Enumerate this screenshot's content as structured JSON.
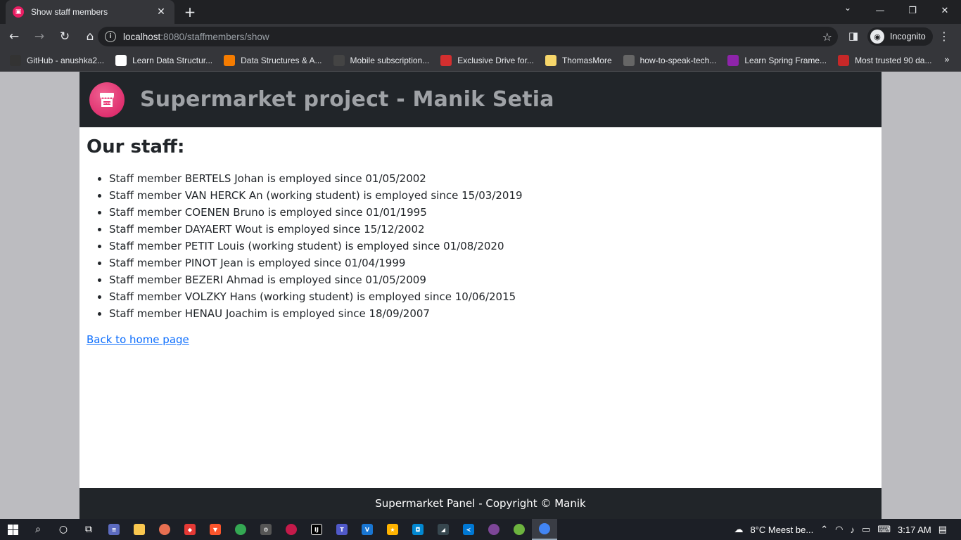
{
  "browser": {
    "tab_title": "Show staff members",
    "url_host": "localhost",
    "url_rest": ":8080/staffmembers/show",
    "profile_label": "Incognito",
    "bookmarks": [
      {
        "label": "GitHub - anushka2...",
        "icon": "github-icon",
        "color": "#333"
      },
      {
        "label": "Learn Data Structur...",
        "icon": "cc-icon",
        "color": "#fff"
      },
      {
        "label": "Data Structures & A...",
        "icon": "cc-orange-icon",
        "color": "#f57c00"
      },
      {
        "label": "Mobile subscription...",
        "icon": "mobile-icon",
        "color": "#444"
      },
      {
        "label": "Exclusive Drive for...",
        "icon": "m-red-icon",
        "color": "#d32f2f"
      },
      {
        "label": "ThomasMore",
        "icon": "folder-icon",
        "color": "#f6d66a"
      },
      {
        "label": "how-to-speak-tech...",
        "icon": "globe-icon",
        "color": "#666"
      },
      {
        "label": "Learn Spring Frame...",
        "icon": "u-purple-icon",
        "color": "#8e24aa"
      },
      {
        "label": "Most trusted 90 da...",
        "icon": "tuf-icon",
        "color": "#c62828"
      }
    ]
  },
  "header": {
    "title": "Supermarket project - Manik Setia"
  },
  "main": {
    "heading": "Our staff:",
    "staff": [
      "Staff member BERTELS Johan is employed since 01/05/2002",
      "Staff member VAN HERCK An (working student) is employed since 15/03/2019",
      "Staff member COENEN Bruno is employed since 01/01/1995",
      "Staff member DAYAERT Wout is employed since 15/12/2002",
      "Staff member PETIT Louis (working student) is employed since 01/08/2020",
      "Staff member PINOT Jean is employed since 01/04/1999",
      "Staff member BEZERI Ahmad is employed since 01/05/2009",
      "Staff member VOLZKY Hans (working student) is employed since 10/06/2015",
      "Staff member HENAU Joachim is employed since 18/09/2007"
    ],
    "back_link": "Back to home page"
  },
  "footer": {
    "text": "Supermarket Panel - Copyright © Manik"
  },
  "taskbar": {
    "weather": "8°C  Meest be...",
    "time": "3:17 AM"
  },
  "colors": {
    "header_bg": "#212529",
    "logo": "#e91e63",
    "link": "#0d6efd"
  }
}
